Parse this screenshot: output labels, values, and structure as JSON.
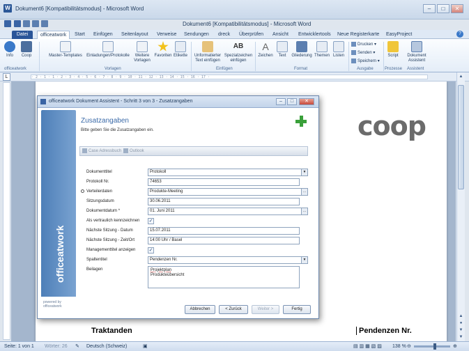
{
  "window": {
    "title": "Dokument6 [Kompatibilitätsmodus] - Microsoft Word",
    "doc_title": "Dokument6 [Kompatibilitätsmodus] - Microsoft Word",
    "app_icon": "W",
    "controls": {
      "minimize": "–",
      "maximize": "□",
      "close": "✕"
    }
  },
  "tabs": [
    "Datei",
    "officeatwork",
    "Start",
    "Einfügen",
    "Seitenlayout",
    "Verweise",
    "Sendungen",
    "dreck",
    "Überprüfen",
    "Ansicht",
    "Entwicklertools",
    "Neue Registerkarte",
    "EasyProject"
  ],
  "ribbon": {
    "buttons": [
      "Info",
      "Coop",
      "Master-Templates",
      "Einladungen/Protokolle",
      "Weitere Vorlagen",
      "Favoriten",
      "Etikette",
      "Unformatierter Text einfügen",
      "Spezialzeichen einfügen",
      "Zeichen",
      "Text",
      "Gliederung",
      "Themen",
      "Listen",
      "Script",
      "Dokument Assistent"
    ],
    "small_buttons": [
      "Drucken",
      "Senden",
      "Speichern"
    ],
    "groups": [
      "officeatwork",
      "Vorlagen",
      "Einfügen",
      "Format",
      "Ausgabe",
      "Prozesse",
      "Assistent"
    ]
  },
  "ruler": {
    "marks": "· 2 · 1 · 1 · 2 · 3 · 4 · 5 · 6 · 7 · 8 · 9 · 10 · 11 · 12 · 13 · 14 · 15 · 16 · 17 ·",
    "tab_selector": "L"
  },
  "document": {
    "logo": "coop",
    "heading_left": "Traktanden",
    "heading_right": "Pendenzen Nr."
  },
  "dialog": {
    "title": "officeatwork Dokument Assistent - Schritt 3 von 3 - Zusatzangaben",
    "heading": "Zusatzangaben",
    "subheading": "Bitte geben Sie die Zusatzangaben ein.",
    "toolbar": {
      "cases": "Case Adressbuch",
      "outlook": "Outlook"
    },
    "sidebar_brand": "officeatwork",
    "powered_by": "powered by officeatwork",
    "fields": {
      "dokumenttitel": {
        "label": "Dokumenttitel",
        "value": "Protokoll"
      },
      "protokoll_nr": {
        "label": "Protokoll Nr.",
        "value": "74653"
      },
      "verteilerdaten": {
        "label": "Verteilerdaten",
        "value": "Produkte-Meeting"
      },
      "sitzungsdatum": {
        "label": "Sitzungsdatum",
        "value": "30.06.2011"
      },
      "dokumentdatum": {
        "label": "Dokumentdatum *",
        "value": "01. Juni 2011"
      },
      "vertraulich": {
        "label": "Als vertraulich kennzeichnen",
        "checked": true
      },
      "naechste_datum": {
        "label": "Nächste Sitzung - Datum",
        "value": "15.07.2011"
      },
      "naechste_zeit": {
        "label": "Nächste Sitzung - Zeit/Ort",
        "value": "14:00 Uhr / Basel"
      },
      "managementtitel": {
        "label": "Managementtitel anzeigen",
        "checked": true
      },
      "spaltentitel": {
        "label": "Spaltentitel",
        "value": "Pendenzen Nr."
      },
      "beilagen": {
        "label": "Beilagen",
        "line1": "Projektplan",
        "line2": "Produkteübersicht"
      }
    },
    "buttons": {
      "cancel": "Abbrechen",
      "back": "< Zurück",
      "next": "Weiter >",
      "finish": "Fertig"
    }
  },
  "status": {
    "page": "Seite: 1 von 1",
    "words": "Wörter: 26",
    "language": "Deutsch (Schweiz)",
    "zoom": "138 %"
  },
  "colors": {
    "accent": "#2a5599",
    "dialog_heading": "#3a6aa8",
    "plus": "#3aa03a"
  }
}
